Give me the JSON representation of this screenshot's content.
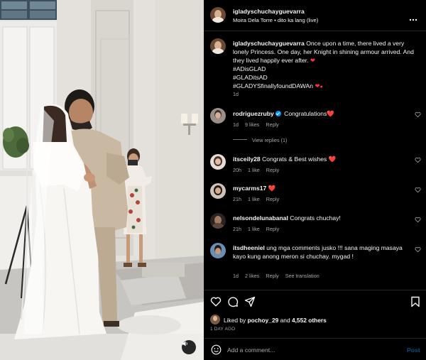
{
  "post": {
    "username": "igladyschuchayguevarra",
    "subtitle": "Moira Dela Torre • dito ka lang (live)",
    "more_icon": "more-horizontal-icon"
  },
  "caption": {
    "username": "igladyschuchayguevarra",
    "text": "Once upon a time, there lived a very lonely Princess. One day, her Knight in shining armour arrived. And they lived happily ever after.",
    "hashtags": [
      "#ADisGLAD",
      "#GLADitsAD",
      "#GLADYSfinallyfoundDAWAn"
    ],
    "time": "1d"
  },
  "comments": [
    {
      "username": "rodriguezruby",
      "verified": true,
      "text": "Congratulations",
      "emoji": "❤️",
      "time": "1d",
      "likes": "9 likes",
      "reply": "Reply",
      "view_replies": "View replies (1)"
    },
    {
      "username": "itsceily28",
      "text": "Congrats & Best wishes",
      "emoji": "❤️",
      "time": "20h",
      "likes": "1 like",
      "reply": "Reply"
    },
    {
      "username": "mycarms17",
      "text": "",
      "emoji": "❤️",
      "time": "21h",
      "likes": "1 like",
      "reply": "Reply"
    },
    {
      "username": "nelsondelunabanal",
      "text": "Congrats chuchay!",
      "time": "21h",
      "likes": "1 like",
      "reply": "Reply"
    },
    {
      "username": "itsdheeniel",
      "text": "ung mga comments jusko !!! sana maging masaya kayo kung anong meron si chuchay. mygad !",
      "time": "1d",
      "likes": "2 likes",
      "reply": "Reply",
      "translation": "See translation"
    }
  ],
  "actions": {
    "liked_by_prefix": "Liked by",
    "liked_by_user": "pochoy_29",
    "liked_by_and": "and",
    "liked_by_others": "4,552 others",
    "date": "1 DAY AGO"
  },
  "composer": {
    "placeholder": "Add a comment...",
    "post_label": "Post"
  },
  "colors": {
    "accent": "#0095f6",
    "heart": "#ff3040",
    "background": "#000000",
    "muted": "#a8a8a8"
  },
  "icons": [
    "heart-icon",
    "comment-icon",
    "share-icon",
    "bookmark-icon",
    "emoji-icon",
    "mute-icon"
  ]
}
